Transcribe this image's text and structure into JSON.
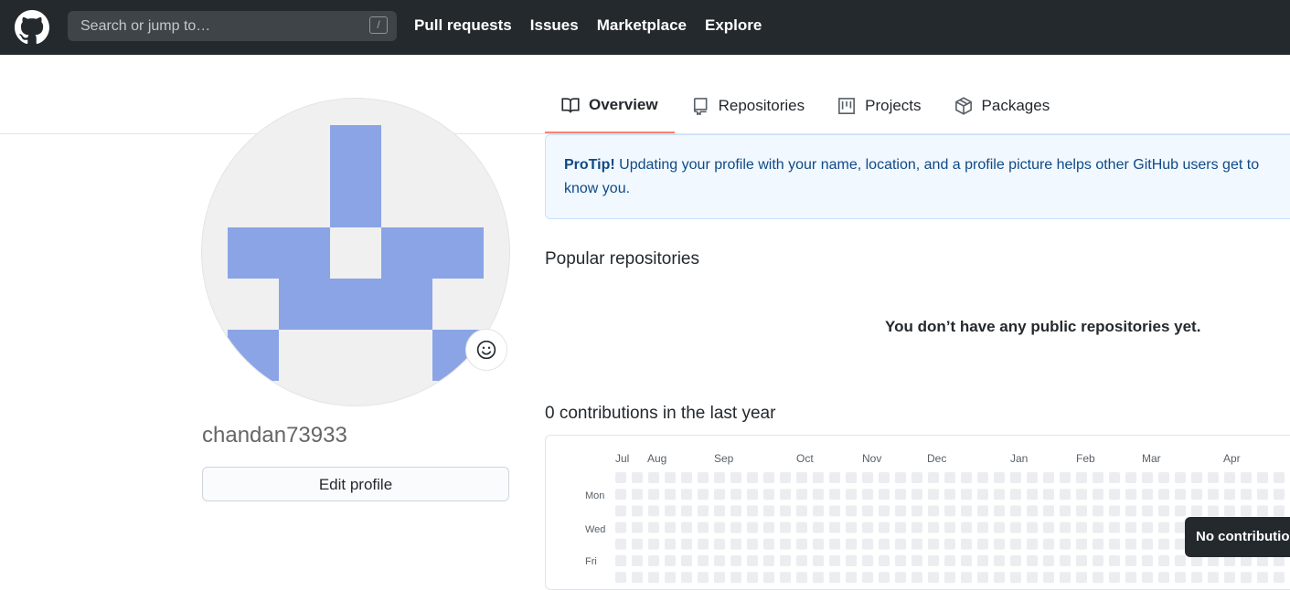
{
  "header": {
    "search_placeholder": "Search or jump to…",
    "search_shortcut": "/",
    "nav": [
      "Pull requests",
      "Issues",
      "Marketplace",
      "Explore"
    ]
  },
  "tabs": [
    {
      "label": "Overview",
      "icon": "book-icon",
      "active": true
    },
    {
      "label": "Repositories",
      "icon": "repo-icon",
      "active": false
    },
    {
      "label": "Projects",
      "icon": "project-icon",
      "active": false
    },
    {
      "label": "Packages",
      "icon": "package-icon",
      "active": false
    }
  ],
  "profile": {
    "username": "chandan73933",
    "edit_label": "Edit profile"
  },
  "protip": {
    "lead": "ProTip!",
    "text": " Updating your profile with your name, location, and a profile picture helps other GitHub users get to know you."
  },
  "popular": {
    "title": "Popular repositories",
    "empty": "You don’t have any public repositories yet."
  },
  "contributions": {
    "title": "0 contributions in the last year",
    "months": [
      "Jul",
      "Aug",
      "Sep",
      "Oct",
      "Nov",
      "Dec",
      "Jan",
      "Feb",
      "Mar",
      "Apr"
    ],
    "days": [
      "Mon",
      "Wed",
      "Fri"
    ],
    "tooltip": "No contributions"
  },
  "colors": {
    "header_bg": "#24292e",
    "avatar_fill": "#8aa4e6",
    "avatar_bg": "#f0f0f0",
    "cell": "#ebedf0",
    "tab_active_border": "#f9826c"
  }
}
